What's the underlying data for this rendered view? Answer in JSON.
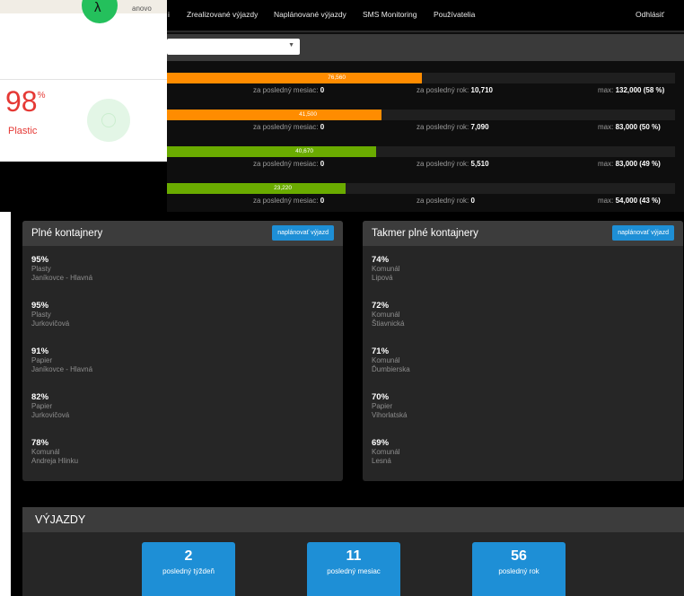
{
  "nav": {
    "partial_item": "i",
    "items": [
      "Zrealizované výjazdy",
      "Naplánované výjazdy",
      "SMS Monitoring",
      "Používatelia"
    ],
    "logout": "Odhlásiť"
  },
  "filter": {
    "select_value": ""
  },
  "bars": [
    {
      "value_label": "76,560",
      "fraction": 0.58,
      "color": "#ff8c00",
      "month_label": "za posledný mesiac:",
      "month_value": "0",
      "year_label": "za posledný rok:",
      "year_value": "10,710",
      "max_label": "max:",
      "max_value": "132,000 (58 %)"
    },
    {
      "value_label": "41,500",
      "fraction": 0.5,
      "color": "#ff8c00",
      "month_label": "za posledný mesiac:",
      "month_value": "0",
      "year_label": "za posledný rok:",
      "year_value": "7,090",
      "max_label": "max:",
      "max_value": "83,000 (50 %)"
    },
    {
      "value_label": "40,670",
      "fraction": 0.49,
      "color": "#6aab00",
      "month_label": "za posledný mesiac:",
      "month_value": "0",
      "year_label": "za posledný rok:",
      "year_value": "5,510",
      "max_label": "max:",
      "max_value": "83,000 (49 %)"
    },
    {
      "value_label": "23,220",
      "fraction": 0.43,
      "color": "#6aab00",
      "month_label": "za posledný mesiac:",
      "month_value": "0",
      "year_label": "za posledný rok:",
      "year_value": "0",
      "max_label": "max:",
      "max_value": "54,000 (43 %)"
    }
  ],
  "phone": {
    "label_partial": "anovo",
    "percent": "98",
    "percent_sign": "%",
    "type": "Plastic",
    "accent": "#e53935",
    "status_green": "#24c05c"
  },
  "full_panel": {
    "title": "Plné kontajnery",
    "button": "naplánovať výjazd",
    "items": [
      {
        "pct": "95%",
        "type": "Plasty",
        "location": "Janíkovce - Hlavná"
      },
      {
        "pct": "95%",
        "type": "Plasty",
        "location": "Jurkovičová"
      },
      {
        "pct": "91%",
        "type": "Papier",
        "location": "Janíkovce - Hlavná"
      },
      {
        "pct": "82%",
        "type": "Papier",
        "location": "Jurkovičová"
      },
      {
        "pct": "78%",
        "type": "Komunál",
        "location": "Andreja Hlinku"
      }
    ]
  },
  "almost_panel": {
    "title": "Takmer plné kontajnery",
    "button": "naplánovať výjazd",
    "items": [
      {
        "pct": "74%",
        "type": "Komunál",
        "location": "Lipová"
      },
      {
        "pct": "72%",
        "type": "Komunál",
        "location": "Štiavnická"
      },
      {
        "pct": "71%",
        "type": "Komunál",
        "location": "Ďumbierska"
      },
      {
        "pct": "70%",
        "type": "Papier",
        "location": "Vihorlatská"
      },
      {
        "pct": "69%",
        "type": "Komunál",
        "location": "Lesná"
      }
    ]
  },
  "vyjazdy": {
    "title": "VÝJAZDY",
    "cards": [
      {
        "value": "2",
        "label": "posledný týždeň"
      },
      {
        "value": "11",
        "label": "posledný mesiac"
      },
      {
        "value": "56",
        "label": "posledný rok"
      }
    ]
  },
  "colors": {
    "accent_blue": "#1e8fd6",
    "orange": "#ff8c00",
    "green": "#6aab00"
  }
}
